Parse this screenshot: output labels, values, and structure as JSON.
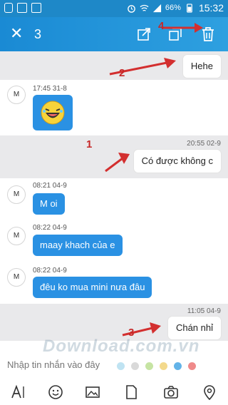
{
  "status_bar": {
    "battery_percent": "66%",
    "time": "15:32"
  },
  "action_bar": {
    "selected_count": "3"
  },
  "messages": {
    "m1": {
      "text": "Hehe"
    },
    "m2": {
      "avatar": "M",
      "time": "17:45 31-8",
      "sticker": "laughing-emoji-sticker"
    },
    "m3": {
      "time": "20:55 02-9",
      "text": "Có được không c"
    },
    "m4": {
      "avatar": "M",
      "time": "08:21 04-9",
      "text": "M oi"
    },
    "m5": {
      "avatar": "M",
      "time": "08:22 04-9",
      "text": "maay khach của e"
    },
    "m6": {
      "avatar": "M",
      "time": "08:22 04-9",
      "text": "đêu ko mua mini nưa đâu"
    },
    "m7": {
      "time": "11:05 04-9",
      "text": "Chán nhỉ"
    }
  },
  "annotations": [
    "1",
    "2",
    "3",
    "4"
  ],
  "watermark": "Download.com.vn",
  "composer": {
    "placeholder": "Nhập tin nhắn vào đây"
  },
  "colors": {
    "accent": "#2a91e3",
    "arrow": "#d32f2f"
  }
}
